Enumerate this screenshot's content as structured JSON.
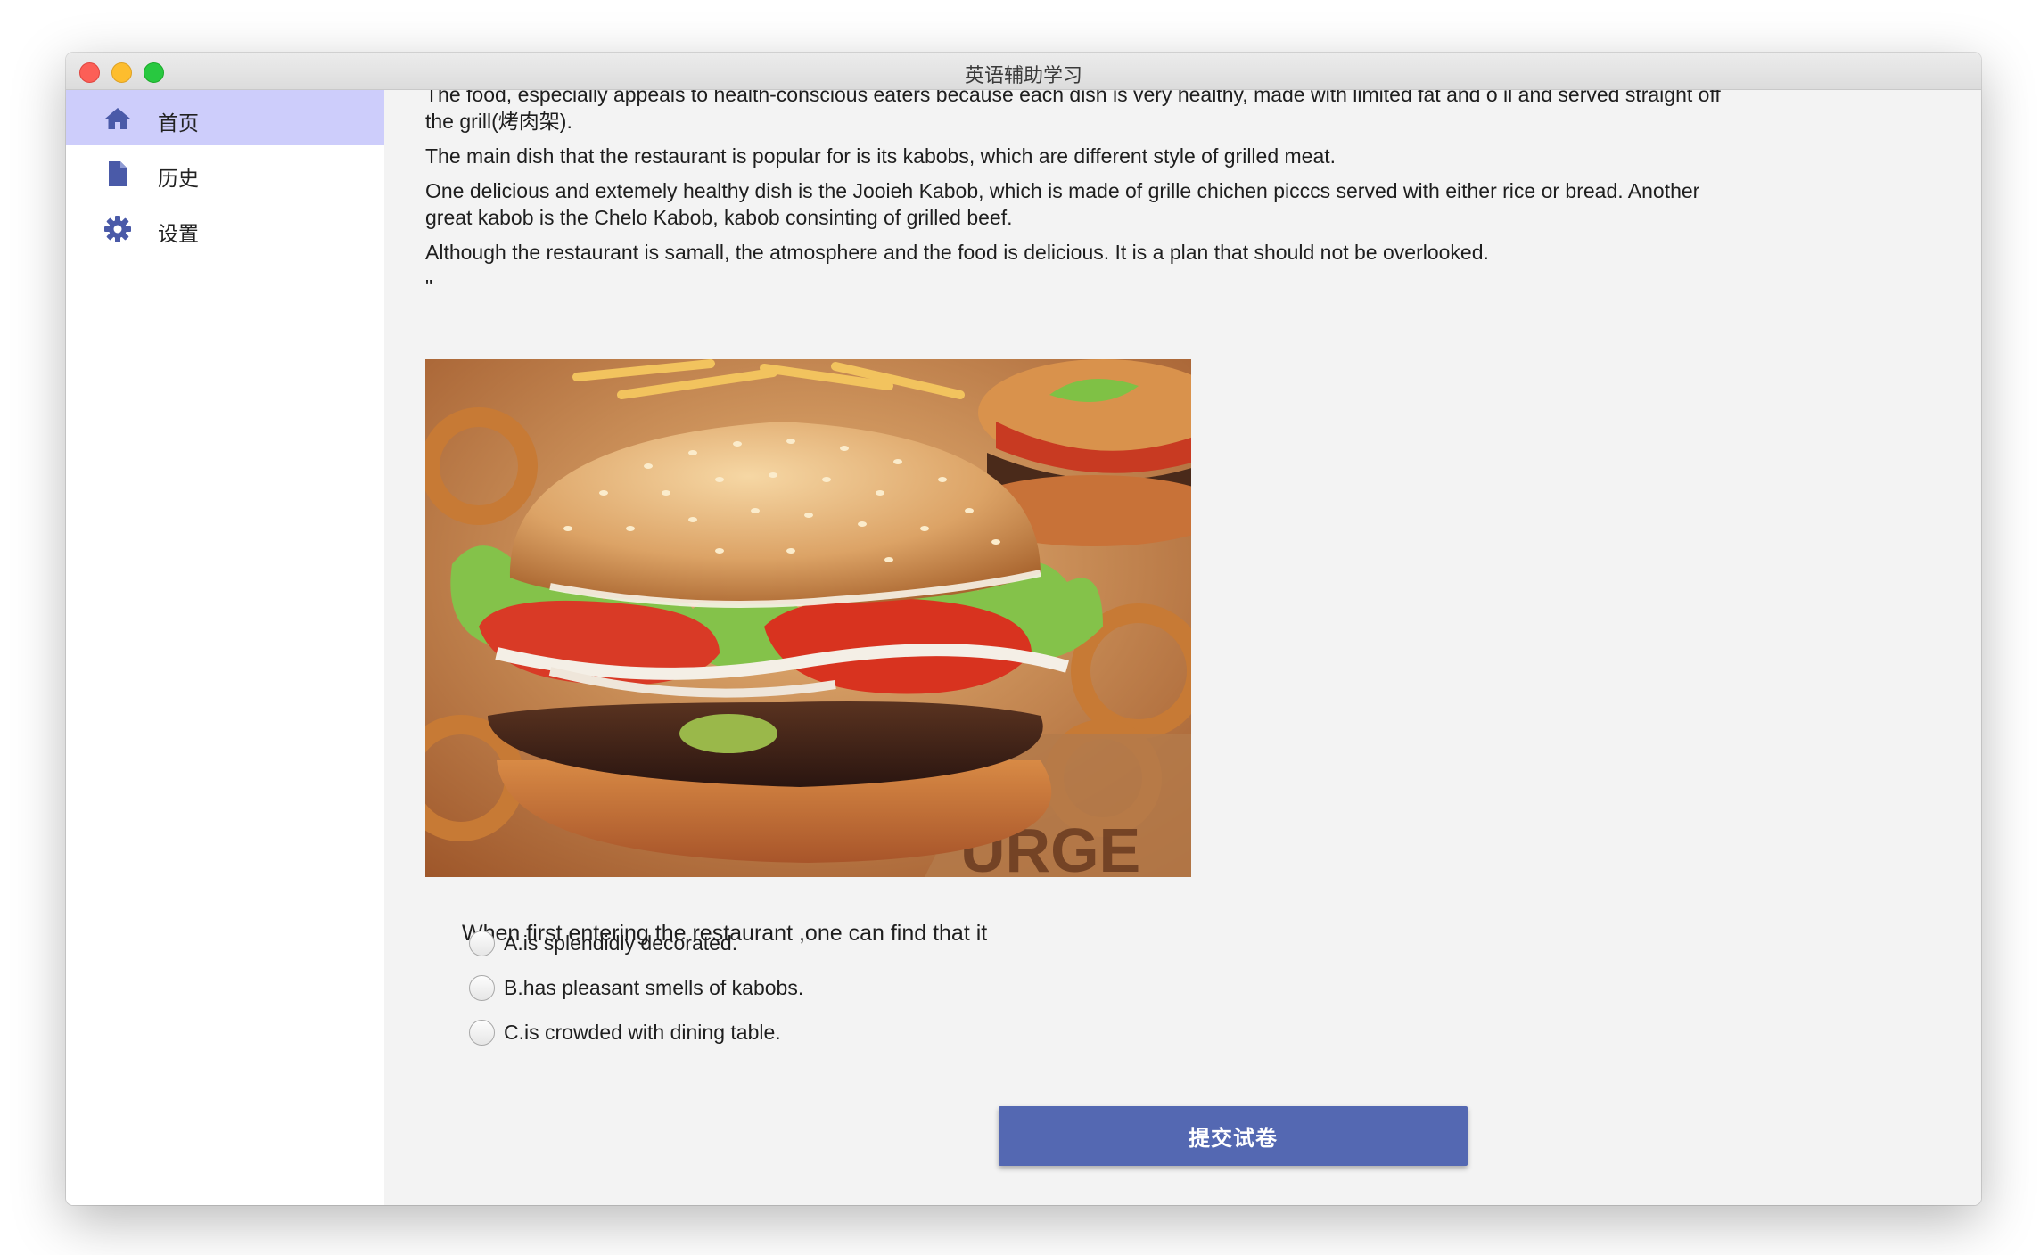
{
  "window": {
    "title": "英语辅助学习"
  },
  "sidebar": {
    "items": [
      {
        "label": "首页",
        "icon": "home-icon",
        "active": true
      },
      {
        "label": "历史",
        "icon": "document-icon",
        "active": false
      },
      {
        "label": "设置",
        "icon": "gear-icon",
        "active": false
      }
    ]
  },
  "article": {
    "paragraphs": [
      "The food, especially appeals to health-conscious eaters because each dish is very healthy, made with limited fat and o il and served straight off the grill(烤肉架).",
      "The main dish that the restaurant is popular for is its kabobs, which are different style of grilled meat.",
      "One delicious and extemely healthy dish is the Jooieh Kabob, which is made of grille chichen picccs served with either rice or bread. Another great kabob is the Chelo Kabob, kabob consinting of grilled beef.",
      "Although the restaurant is samall, the atmosphere and the food is delicious. It is a plan that should not be overlooked."
    ],
    "closing_quote": "\""
  },
  "quiz": {
    "question": "When first entering the restaurant ,one can find that it",
    "options": [
      "A.is splendidly decorated.",
      "B.has pleasant smells of kabobs.",
      "C.is crowded with dining table."
    ]
  },
  "actions": {
    "submit_label": "提交试卷"
  },
  "colors": {
    "sidebar_active": "#cdcdfb",
    "icon": "#4a5aa8",
    "submit_button": "#5468b2",
    "content_background": "#f3f3f3"
  }
}
